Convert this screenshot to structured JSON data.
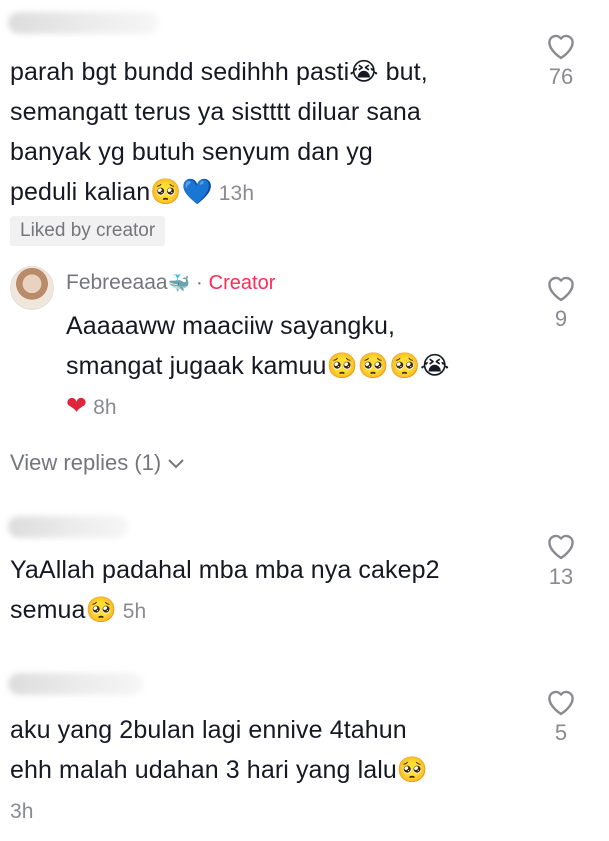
{
  "comment1": {
    "lines": [
      "parah bgt bundd sedihhh pasti",
      " but,",
      "semangatt terus ya sistttt diluar sana",
      "banyak yg butuh senyum dan yg",
      "peduli kalian"
    ],
    "time": "13h",
    "likes": "76",
    "badge": "Liked by creator"
  },
  "reply": {
    "username": "Febreeaaa",
    "separator": " · ",
    "creator_label": "Creator",
    "line1": "Aaaaaww maaciiw sayangku,",
    "line2": "smangat jugaak kamuu",
    "time": "8h",
    "likes": "9"
  },
  "view_replies": "View replies (1)",
  "comment2": {
    "line1": "YaAllah padahal mba mba nya cakep2",
    "line2": "semua",
    "time": "5h",
    "likes": "13"
  },
  "comment3": {
    "line1": "aku yang 2bulan lagi ennive 4tahun",
    "line2": "ehh malah udahan 3 hari yang lalu",
    "time": "3h",
    "likes": "5"
  },
  "colors": {
    "text": "#161823",
    "muted": "#8a8b91",
    "creator": "#fe2c55",
    "heart_red": "#e0243b",
    "heart_blue": "#2b8cff"
  },
  "icons": [
    "heart-outline-icon",
    "crying-face-emoji",
    "pleading-face-emoji",
    "blue-heart-emoji",
    "red-heart-emoji",
    "chevron-down-icon",
    "whale-emoji"
  ]
}
